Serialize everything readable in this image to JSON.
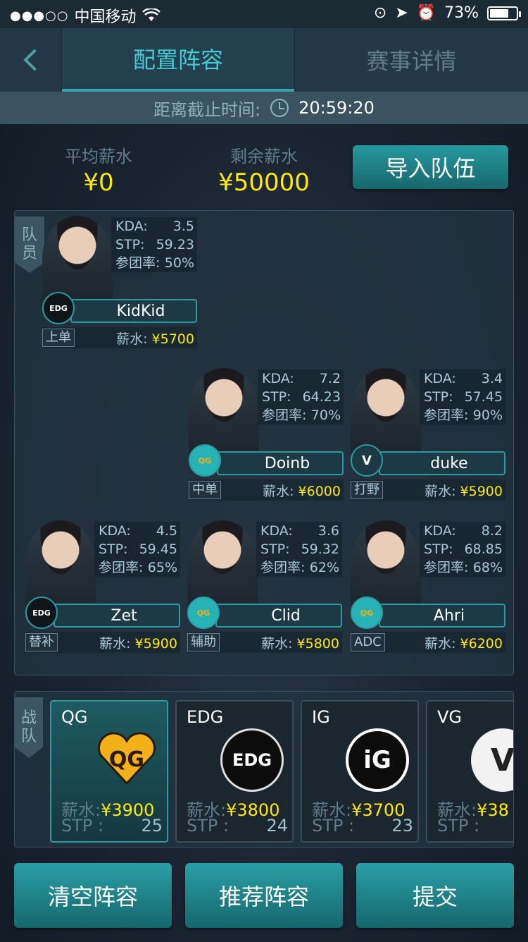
{
  "status_bar": {
    "carrier": "中国移动",
    "battery_percent": "73%",
    "battery_level": 0.73
  },
  "nav": {
    "tabs": [
      {
        "label": "配置阵容",
        "active": true
      },
      {
        "label": "赛事详情",
        "active": false
      }
    ]
  },
  "deadline": {
    "label": "距离截止时间:",
    "time": "20:59:20"
  },
  "summary": {
    "avg_label": "平均薪水",
    "avg_value": "¥0",
    "remaining_label": "剩余薪水",
    "remaining_value": "¥50000",
    "import_button": "导入队伍"
  },
  "roster": {
    "side_label_1": "队",
    "side_label_2": "员",
    "salary_prefix": "薪水: ",
    "kda_label": "KDA:",
    "stp_label": "STP:",
    "team_rate_label": "参团率:",
    "players": [
      {
        "name": "KidKid",
        "team": "EDG",
        "position": "上单",
        "kda": "3.5",
        "stp": "59.23",
        "team_rate": "50%",
        "salary": "¥5700"
      },
      {
        "name": "Doinb",
        "team": "QG",
        "position": "中单",
        "kda": "7.2",
        "stp": "64.23",
        "team_rate": "70%",
        "salary": "¥6000"
      },
      {
        "name": "duke",
        "team": "VG",
        "position": "打野",
        "kda": "3.4",
        "stp": "57.45",
        "team_rate": "90%",
        "salary": "¥5900"
      },
      {
        "name": "Zet",
        "team": "EDG",
        "position": "替补",
        "kda": "4.5",
        "stp": "59.45",
        "team_rate": "65%",
        "salary": "¥5900"
      },
      {
        "name": "Clid",
        "team": "QG",
        "position": "辅助",
        "kda": "3.6",
        "stp": "59.32",
        "team_rate": "62%",
        "salary": "¥5800"
      },
      {
        "name": "Ahri",
        "team": "QG",
        "position": "ADC",
        "kda": "8.2",
        "stp": "68.85",
        "team_rate": "68%",
        "salary": "¥6200"
      }
    ]
  },
  "teams": {
    "side_label_1": "战",
    "side_label_2": "队",
    "salary_label": "薪水:",
    "stp_label": "STP :",
    "items": [
      {
        "name": "QG",
        "salary": "¥3900",
        "stp": "25",
        "selected": true
      },
      {
        "name": "EDG",
        "salary": "¥3800",
        "stp": "24",
        "selected": false
      },
      {
        "name": "IG",
        "salary": "¥3700",
        "stp": "23",
        "selected": false
      },
      {
        "name": "VG",
        "salary": "¥38",
        "stp": "",
        "selected": false
      }
    ]
  },
  "buttons": {
    "clear": "清空阵容",
    "recommend": "推荐阵容",
    "submit": "提交"
  },
  "colors": {
    "accent": "#46c9d5",
    "muted": "#607d8b",
    "money": "#ffea00",
    "stat": "#a9c8d7"
  },
  "logo_texts": {
    "edg": "EDG",
    "qg": "QG",
    "vg": "V",
    "ig": "iG"
  }
}
